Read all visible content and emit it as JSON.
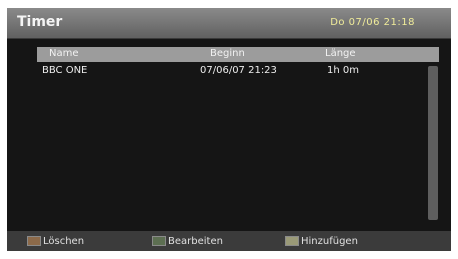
{
  "header": {
    "title": "Timer",
    "datetime": "Do 07/06 21:18"
  },
  "table": {
    "columns": [
      "Name",
      "Beginn",
      "Länge"
    ],
    "rows": [
      {
        "name": "BBC ONE",
        "begin": "07/06/07  21:23",
        "length": "1h 0m"
      }
    ]
  },
  "footer": {
    "buttons": [
      {
        "label": "Löschen",
        "color": "#8c6a4a"
      },
      {
        "label": "Bearbeiten",
        "color": "#5d6f52"
      },
      {
        "label": "Hinzufügen",
        "color": "#9a9a78"
      }
    ]
  },
  "colors": {
    "clock_text": "#f0ec9a",
    "background": "#1c1c1c",
    "header_bar": "#8a8a8a"
  }
}
